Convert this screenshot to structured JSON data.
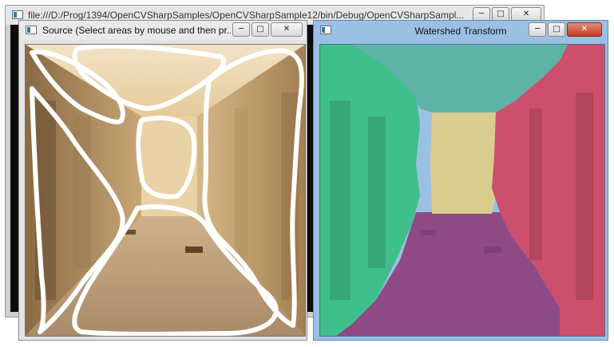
{
  "console_window": {
    "title": "file:///D:/Prog/1394/OpenCVSharpSamples/OpenCVSharpSample12/bin/Debug/OpenCVSharpSampl...",
    "minimize_label": "─",
    "maximize_label": "□",
    "close_label": "✕"
  },
  "source_window": {
    "title": "Source (Select areas by mouse and then pr...",
    "minimize_label": "─",
    "maximize_label": "□",
    "close_label": "✕"
  },
  "watershed_window": {
    "title": "Watershed Transform",
    "minimize_label": "─",
    "maximize_label": "□",
    "close_label": "✕"
  },
  "colors": {
    "segment_left": "#3fbf8c",
    "segment_ceiling": "#5fb3a6",
    "segment_right": "#cc4f6d",
    "segment_end": "#d9cc8f",
    "segment_floor": "#8e4a85",
    "marker_stroke": "#ffffff",
    "close_button": "#c23d22"
  },
  "icons": {
    "app": "app-window-icon",
    "minimize": "minimize-icon",
    "maximize": "maximize-icon",
    "close": "close-icon"
  }
}
